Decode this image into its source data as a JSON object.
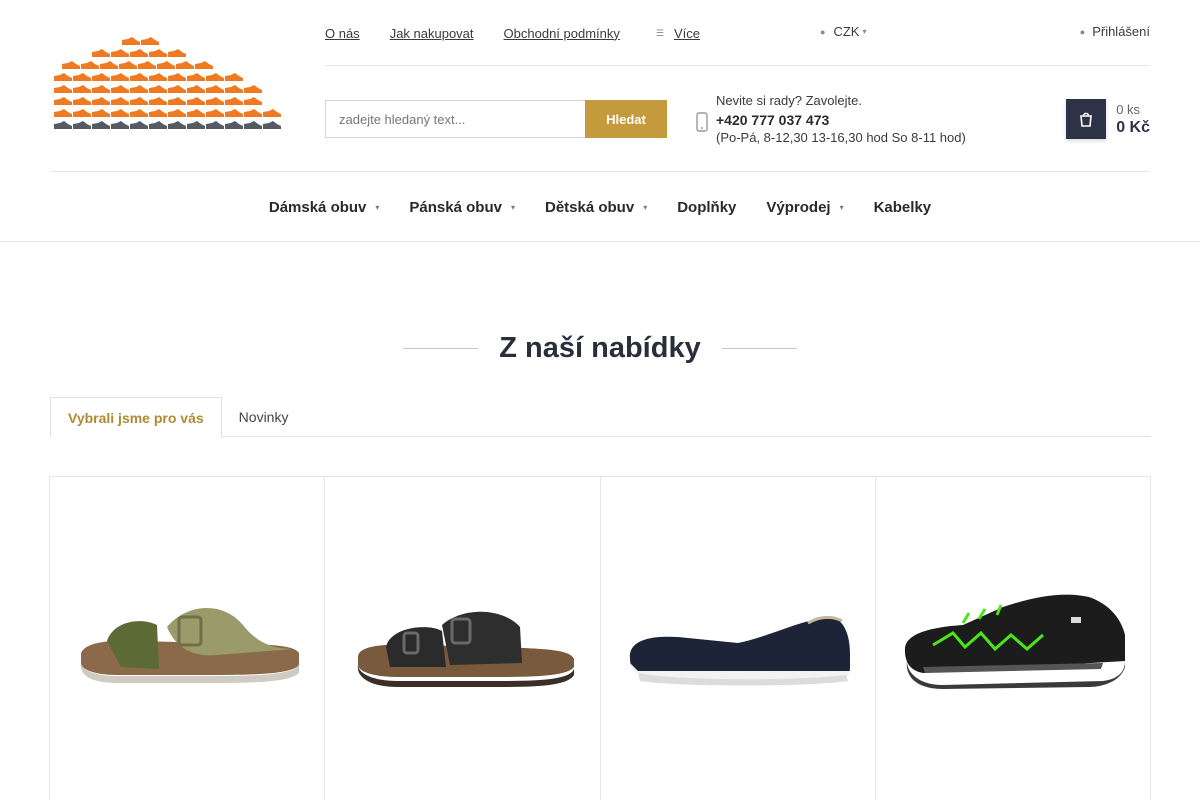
{
  "header": {
    "logo_label": "shoe-stack-logo",
    "top_links": [
      "O nás",
      "Jak nakupovat",
      "Obchodní podmínky"
    ],
    "more_label": "Více",
    "currency": "CZK",
    "login_label": "Přihlášení"
  },
  "search": {
    "placeholder": "zadejte hledaný text...",
    "button_label": "Hledat"
  },
  "contact": {
    "line1": "Nevite si rady? Zavolejte.",
    "phone": "+420 777 037 473",
    "hours": "(Po-Pá, 8-12,30 13-16,30 hod So 8-11 hod)"
  },
  "cart": {
    "qty": "0 ks",
    "price": "0 Kč"
  },
  "nav": {
    "items": [
      {
        "label": "Dámská obuv",
        "has_dropdown": true
      },
      {
        "label": "Pánská obuv",
        "has_dropdown": true
      },
      {
        "label": "Dětská obuv",
        "has_dropdown": true
      },
      {
        "label": "Doplňky",
        "has_dropdown": false
      },
      {
        "label": "Výprodej",
        "has_dropdown": true
      },
      {
        "label": "Kabelky",
        "has_dropdown": false
      }
    ]
  },
  "section": {
    "title": "Z naší nabídky",
    "tabs": [
      "Vybrali jsme pro vás",
      "Novinky"
    ],
    "active_tab": 0
  },
  "products": [
    {
      "image": "olive-metallic-buckle-sandal"
    },
    {
      "image": "black-two-strap-slide-sandal"
    },
    {
      "image": "navy-slip-on-sneaker"
    },
    {
      "image": "black-green-kids-sneaker"
    }
  ],
  "colors": {
    "accent_gold": "#c49a3c",
    "active_tab_text": "#b08a30",
    "cart_button": "#2d3246",
    "logo_orange": "#f07a22",
    "logo_gray": "#555a63"
  }
}
